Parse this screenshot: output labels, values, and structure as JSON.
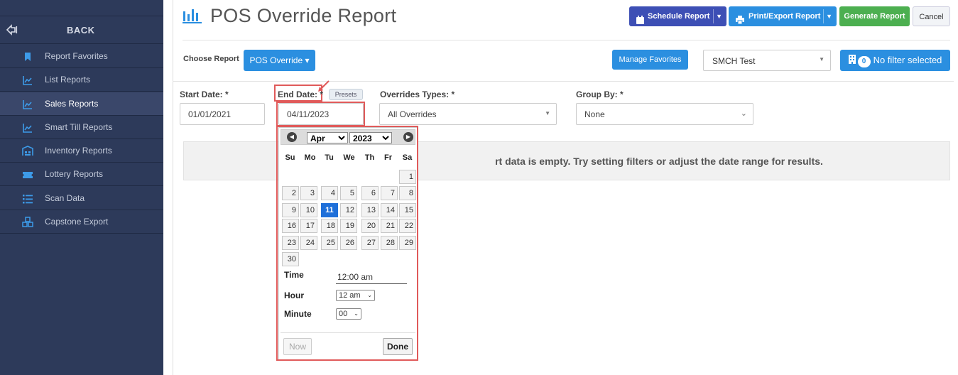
{
  "sidebar": {
    "back_label": "BACK",
    "items": [
      {
        "label": "Report Favorites",
        "icon": "bookmark-icon"
      },
      {
        "label": "List Reports",
        "icon": "chart-line-icon"
      },
      {
        "label": "Sales Reports",
        "icon": "chart-line-icon",
        "active": true
      },
      {
        "label": "Smart Till Reports",
        "icon": "chart-line-icon"
      },
      {
        "label": "Inventory Reports",
        "icon": "warehouse-icon"
      },
      {
        "label": "Lottery Reports",
        "icon": "ticket-icon"
      },
      {
        "label": "Scan Data",
        "icon": "list-icon"
      },
      {
        "label": "Capstone Export",
        "icon": "cubes-icon"
      }
    ]
  },
  "header": {
    "title": "POS Override Report",
    "schedule_label": "Schedule Report",
    "print_label": "Print/Export Report",
    "generate_label": "Generate Report",
    "cancel_label": "Cancel"
  },
  "toolbar": {
    "choose_label": "Choose Report",
    "report_button": "POS Override ▾",
    "manage_favorites": "Manage Favorites",
    "store_value": "SMCH Test",
    "filter_count": "0",
    "filter_label": "No filter selected"
  },
  "filters": {
    "start_label": "Start Date: *",
    "start_value": "01/01/2021",
    "end_label": "End Date: *",
    "presets_label": "Presets",
    "end_value": "04/11/2023",
    "overrides_label": "Overrides Types: *",
    "overrides_value": "All Overrides",
    "group_label": "Group By: *",
    "group_value": "None"
  },
  "empty_message": "rt data is empty. Try setting filters or adjust the date range for results.",
  "calendar": {
    "month": "Apr",
    "year": "2023",
    "weekdays": [
      "Su",
      "Mo",
      "Tu",
      "We",
      "Th",
      "Fr",
      "Sa"
    ],
    "selected_day": "11",
    "time_label": "Time",
    "time_value": "12:00 am",
    "hour_label": "Hour",
    "hour_value": "12 am",
    "minute_label": "Minute",
    "minute_value": "00",
    "now_label": "Now",
    "done_label": "Done"
  },
  "colors": {
    "sidebar_bg": "#2d3a5a",
    "primary": "#2b8fe0",
    "schedule": "#3d4fb5",
    "generate": "#4caf50",
    "highlight": "#e05a5a"
  }
}
